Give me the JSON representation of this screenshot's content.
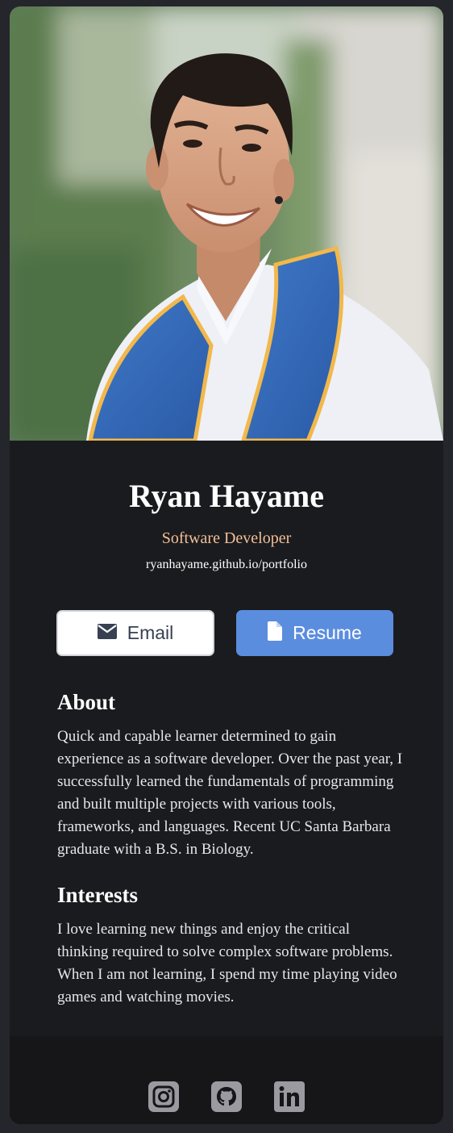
{
  "profile": {
    "photo_alt": "portrait-photo",
    "name": "Ryan Hayame",
    "role": "Software Developer",
    "website": "ryanhayame.github.io/portfolio"
  },
  "actions": {
    "email_label": "Email",
    "resume_label": "Resume"
  },
  "about": {
    "heading": "About",
    "text": "Quick and capable learner determined to gain experience as a software developer. Over the past year, I successfully learned the fundamentals of programming and built multiple projects with various tools, frameworks, and languages. Recent UC Santa Barbara graduate with a B.S. in Biology."
  },
  "interests": {
    "heading": "Interests",
    "text": "I love learning new things and enjoy the critical thinking required to solve complex software problems. When I am not learning, I spend my time playing video games and watching movies."
  },
  "footer": {
    "icons": [
      "instagram-icon",
      "github-icon",
      "linkedin-icon"
    ]
  },
  "colors": {
    "page_bg": "#24262b",
    "card_bg": "#1a1b1e",
    "footer_bg": "#161618",
    "role_accent": "#f3bf99",
    "resume_button": "#5b8ddf",
    "icon_gray": "#9a9aa0"
  }
}
